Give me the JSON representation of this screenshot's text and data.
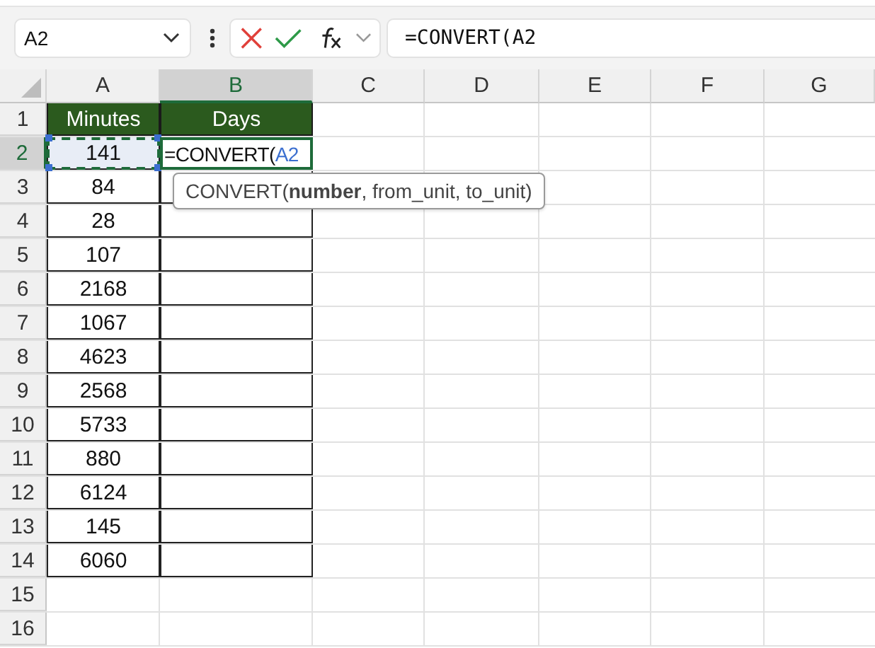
{
  "name_box": {
    "value": "A2"
  },
  "formula_bar": {
    "value": "=CONVERT(A2"
  },
  "columns": [
    {
      "label": "A",
      "selected": false
    },
    {
      "label": "B",
      "selected": true
    },
    {
      "label": "C",
      "selected": false
    },
    {
      "label": "D",
      "selected": false
    },
    {
      "label": "E",
      "selected": false
    },
    {
      "label": "F",
      "selected": false
    },
    {
      "label": "G",
      "selected": false
    }
  ],
  "rows": [
    {
      "label": "1",
      "selected": false,
      "kind": "header",
      "cells": [
        "Minutes",
        "Days"
      ]
    },
    {
      "label": "2",
      "selected": true,
      "kind": "data",
      "referenced": true,
      "editing": true,
      "cells": [
        "141"
      ]
    },
    {
      "label": "3",
      "selected": false,
      "kind": "data",
      "cells": [
        "84"
      ]
    },
    {
      "label": "4",
      "selected": false,
      "kind": "data",
      "cells": [
        "28"
      ]
    },
    {
      "label": "5",
      "selected": false,
      "kind": "data",
      "cells": [
        "107"
      ]
    },
    {
      "label": "6",
      "selected": false,
      "kind": "data",
      "cells": [
        "2168"
      ]
    },
    {
      "label": "7",
      "selected": false,
      "kind": "data",
      "cells": [
        "1067"
      ]
    },
    {
      "label": "8",
      "selected": false,
      "kind": "data",
      "cells": [
        "4623"
      ]
    },
    {
      "label": "9",
      "selected": false,
      "kind": "data",
      "cells": [
        "2568"
      ]
    },
    {
      "label": "10",
      "selected": false,
      "kind": "data",
      "cells": [
        "5733"
      ]
    },
    {
      "label": "11",
      "selected": false,
      "kind": "data",
      "cells": [
        "880"
      ]
    },
    {
      "label": "12",
      "selected": false,
      "kind": "data",
      "cells": [
        "6124"
      ]
    },
    {
      "label": "13",
      "selected": false,
      "kind": "data",
      "cells": [
        "145"
      ]
    },
    {
      "label": "14",
      "selected": false,
      "kind": "data",
      "cells": [
        "6060"
      ]
    },
    {
      "label": "15",
      "selected": false,
      "kind": "empty"
    },
    {
      "label": "16",
      "selected": false,
      "kind": "empty"
    }
  ],
  "active_cell": {
    "formula": "=CONVERT(",
    "reference": "A2"
  },
  "tooltip": "CONVERT(**number**, from_unit, to_unit)"
}
